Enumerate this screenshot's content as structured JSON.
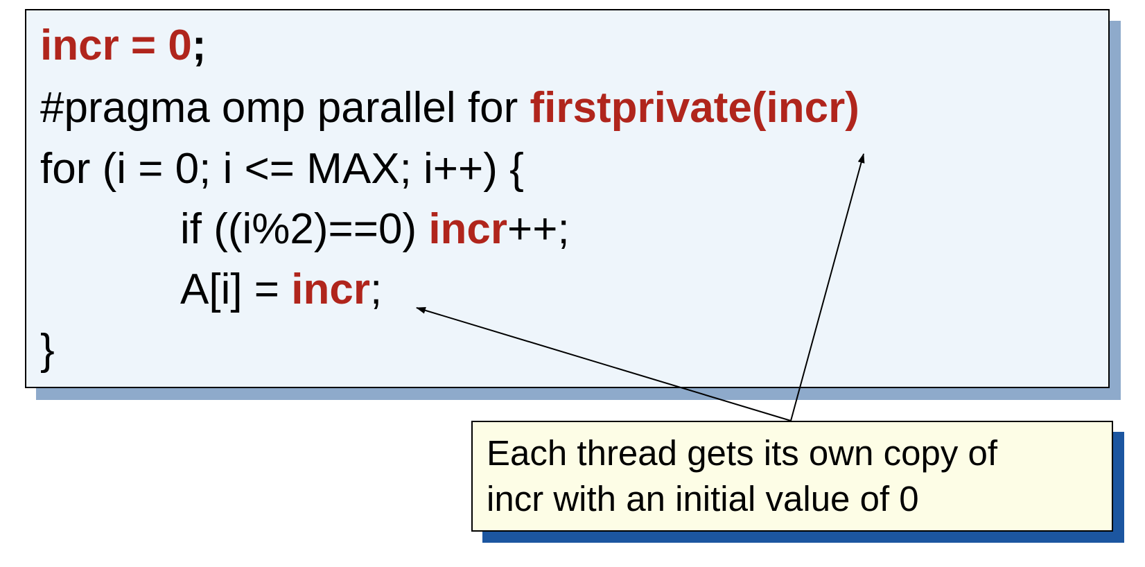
{
  "code": {
    "line1": {
      "prefix": "incr = 0",
      "suffix": ";"
    },
    "line2": {
      "text": "#pragma omp parallel for ",
      "clause": "firstprivate(incr)"
    },
    "line3": {
      "text": "for (i = 0; i <= MAX; i++) {"
    },
    "line4": {
      "prefix": "if ((i%2)==0) ",
      "var": "incr",
      "suffix": "++;"
    },
    "line5": {
      "prefix": "A[i] = ",
      "var": "incr",
      "suffix": ";"
    },
    "line6": {
      "text": "}"
    }
  },
  "note": {
    "line1": "Each thread gets its own copy of",
    "line2": "incr with an initial value of 0"
  },
  "colors": {
    "highlight": "#b0251c",
    "code_box_fill": "#eef5fb",
    "code_box_shadow": "#8eaacb",
    "note_fill": "#fdfde6",
    "note_shadow": "#1c56a0"
  }
}
